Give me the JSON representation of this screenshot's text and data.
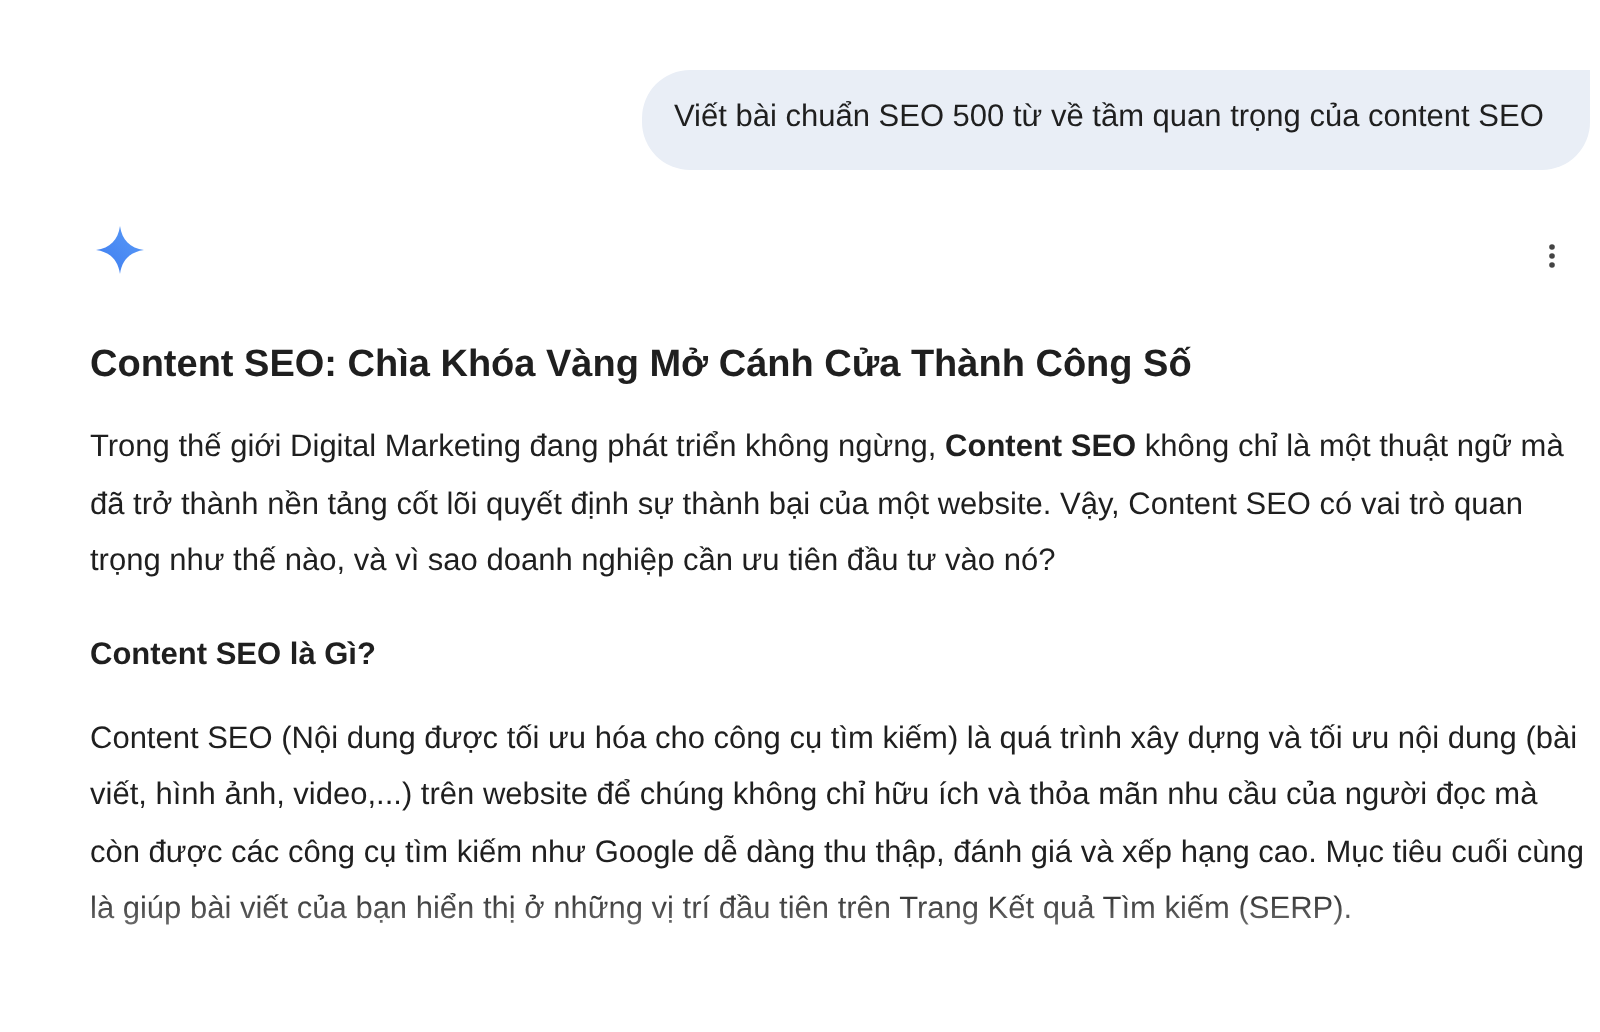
{
  "user_message": {
    "text": "Viết bài chuẩn SEO 500 từ về tầm quan trọng của content SEO"
  },
  "response": {
    "title": "Content SEO: Chìa Khóa Vàng Mở Cánh Cửa Thành Công Số",
    "blocks": [
      {
        "kind": "paragraph",
        "text": "Trong thế giới Digital Marketing đang phát triển không ngừng, **Content SEO** không chỉ là một thuật ngữ mà đã trở thành nền tảng cốt lõi quyết định sự thành bại của một website. Vậy, Content SEO có vai trò quan trọng như thế nào, và vì sao doanh nghiệp cần ưu tiên đầu tư vào nó?"
      },
      {
        "kind": "heading",
        "text": "Content SEO là Gì?"
      },
      {
        "kind": "paragraph",
        "text": "Content SEO (Nội dung được tối ưu hóa cho công cụ tìm kiếm) là quá trình xây dựng và tối ưu nội dung (bài viết, hình ảnh, video,...) trên website để chúng không chỉ hữu ích và thỏa mãn nhu cầu của người đọc mà còn được các công cụ tìm kiếm như Google dễ dàng thu thập, đánh giá và xếp hạng cao. Mục tiêu cuối cùng là giúp bài viết của bạn hiển thị ở những vị trí đầu tiên trên Trang Kết quả Tìm kiếm (SERP)."
      }
    ]
  }
}
